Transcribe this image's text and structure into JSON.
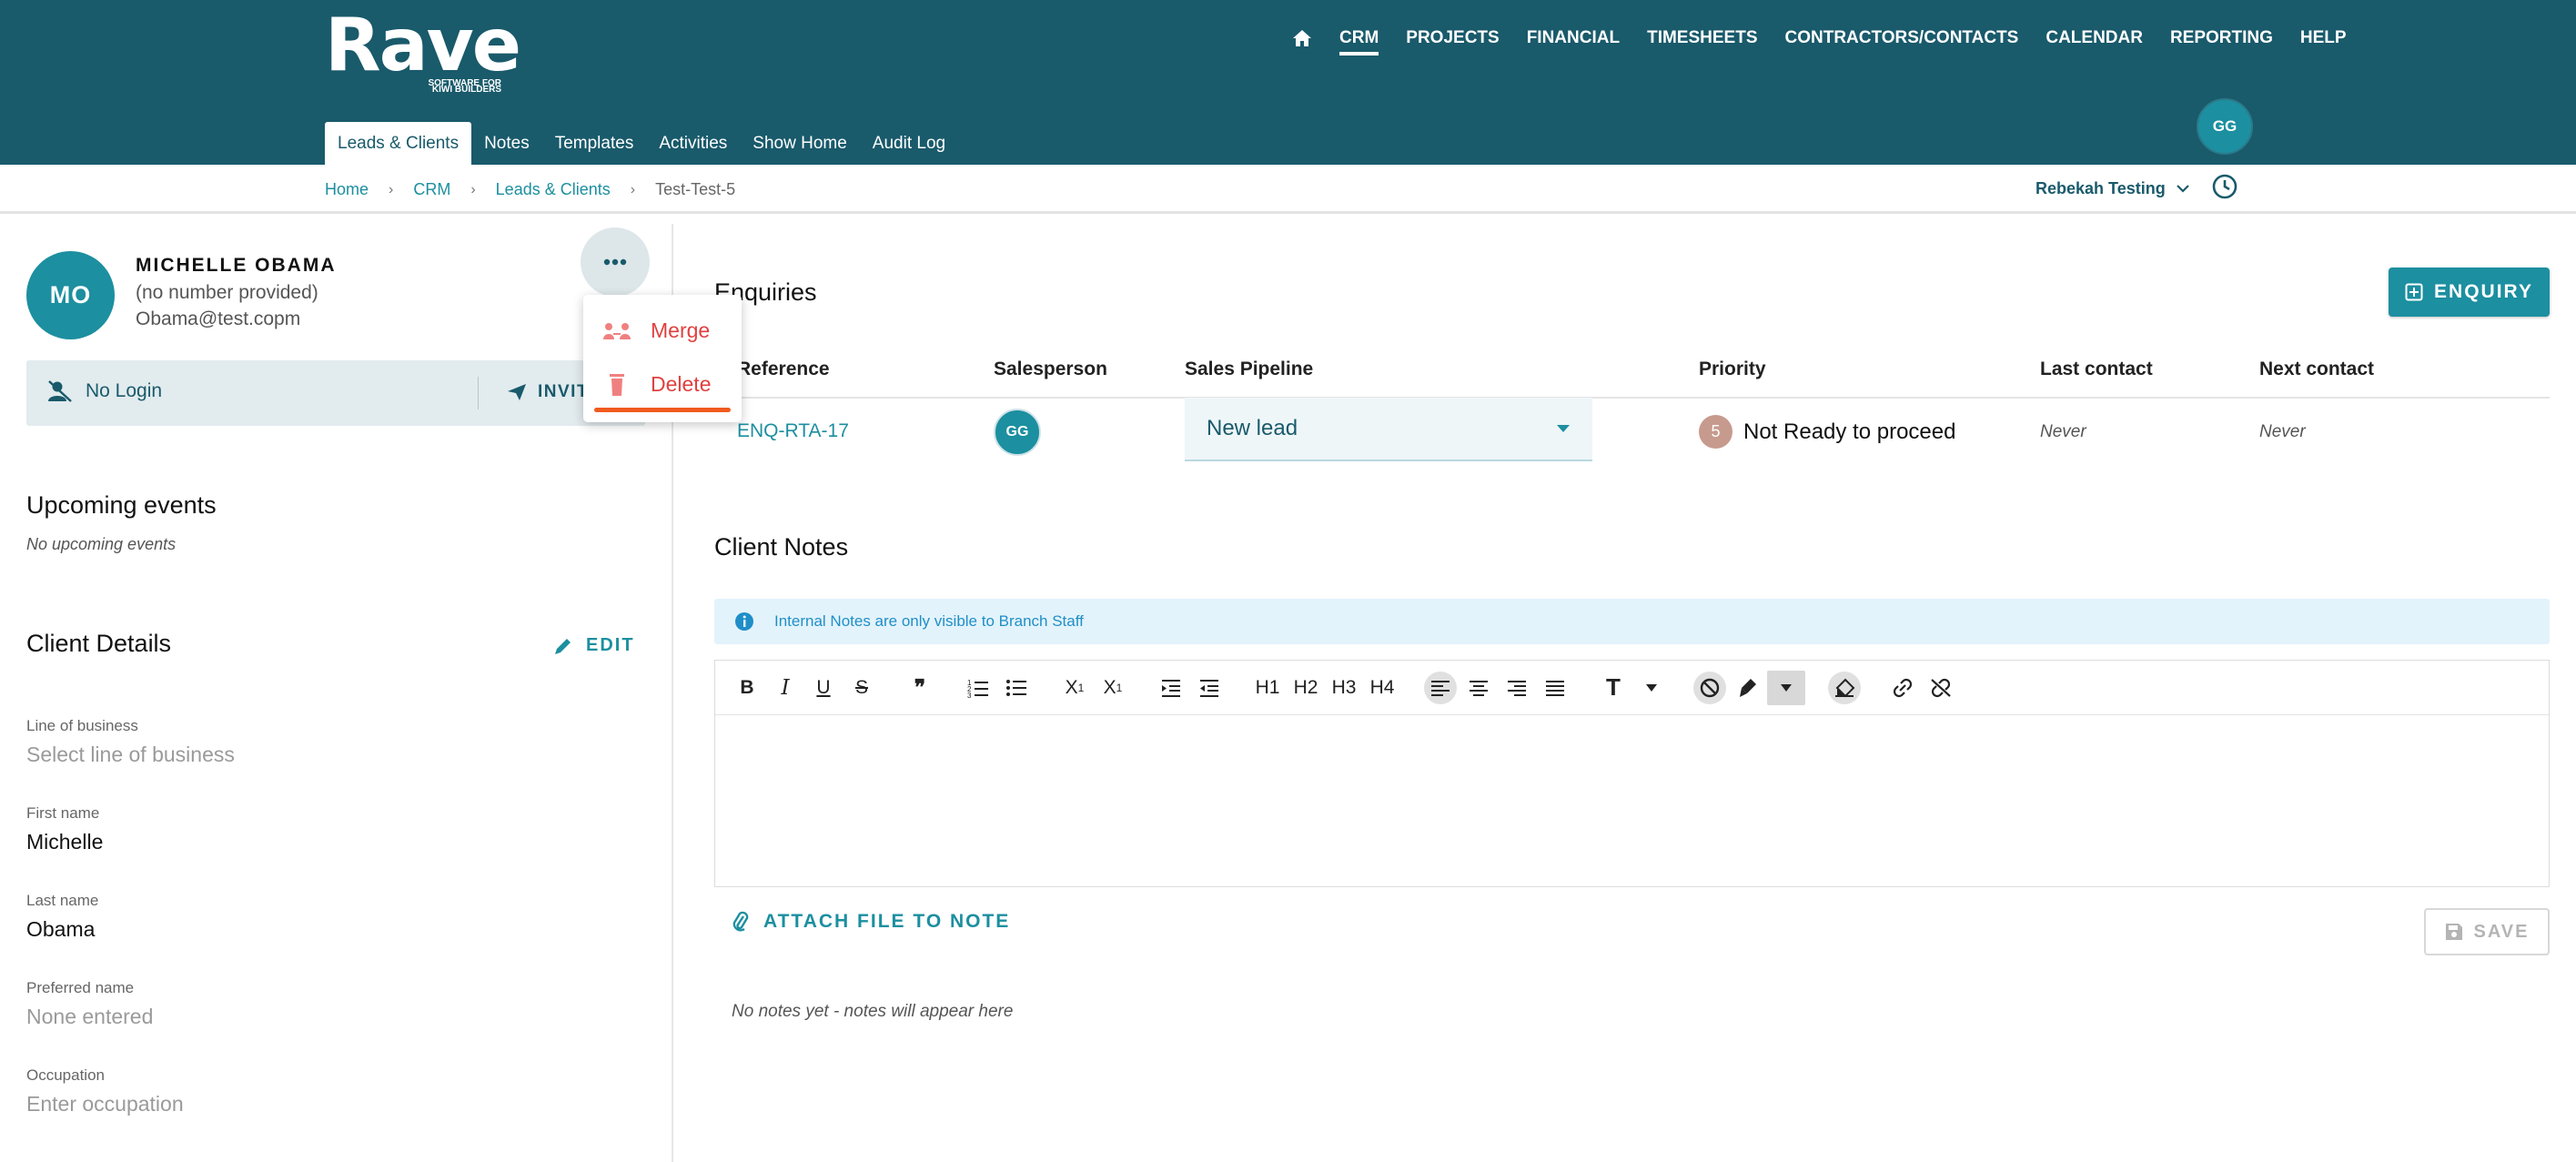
{
  "app": {
    "logo": {
      "wordmark": "Rave",
      "tagline_line1": "SOFTWARE FOR",
      "tagline_line2": "KIWI BUILDERS"
    },
    "user_initials": "GG"
  },
  "topnav": [
    "CRM",
    "PROJECTS",
    "FINANCIAL",
    "TIMESHEETS",
    "CONTRACTORS/CONTACTS",
    "CALENDAR",
    "REPORTING",
    "HELP"
  ],
  "subnav": [
    "Leads & Clients",
    "Notes",
    "Templates",
    "Activities",
    "Show Home",
    "Audit Log"
  ],
  "breadcrumb": [
    "Home",
    "CRM",
    "Leads & Clients",
    "Test-Test-5"
  ],
  "company_selector": "Rebekah Testing",
  "client": {
    "initials": "MO",
    "name": "MICHELLE OBAMA",
    "phone": "(no number provided)",
    "email": "Obama@test.copm",
    "login_status": "No Login",
    "invite_label": "INVITE"
  },
  "actions_menu": {
    "merge": "Merge",
    "delete": "Delete"
  },
  "upcoming_events": {
    "title": "Upcoming events",
    "empty": "No upcoming events"
  },
  "client_details": {
    "title": "Client Details",
    "edit_label": "EDIT",
    "fields": [
      {
        "label": "Line of business",
        "value": "Select line of business"
      },
      {
        "label": "First name",
        "value": "Michelle"
      },
      {
        "label": "Last name",
        "value": "Obama"
      },
      {
        "label": "Preferred name",
        "value": "None entered"
      },
      {
        "label": "Occupation",
        "value": "Enter occupation"
      }
    ]
  },
  "enquiries": {
    "title": "Enquiries",
    "add_button": "ENQUIRY",
    "columns": [
      "Reference",
      "Salesperson",
      "Sales Pipeline",
      "Priority",
      "Last contact",
      "Next contact"
    ],
    "rows": [
      {
        "reference": "ENQ-RTA-17",
        "salesperson": "GG",
        "pipeline": "New lead",
        "priority_number": "5",
        "priority_label": "Not Ready to proceed",
        "last_contact": "Never",
        "next_contact": "Never"
      }
    ]
  },
  "client_notes": {
    "title": "Client Notes",
    "info": "Internal Notes are only visible to Branch Staff",
    "toolbar_headings": [
      "H1",
      "H2",
      "H3",
      "H4"
    ],
    "attach_label": "ATTACH FILE TO NOTE",
    "save_label": "SAVE",
    "empty": "No notes yet - notes will appear here"
  },
  "colors": {
    "header": "#195a6b",
    "accent": "#1c8fa0",
    "danger": "#e04040",
    "highlight": "#f05a1e"
  }
}
